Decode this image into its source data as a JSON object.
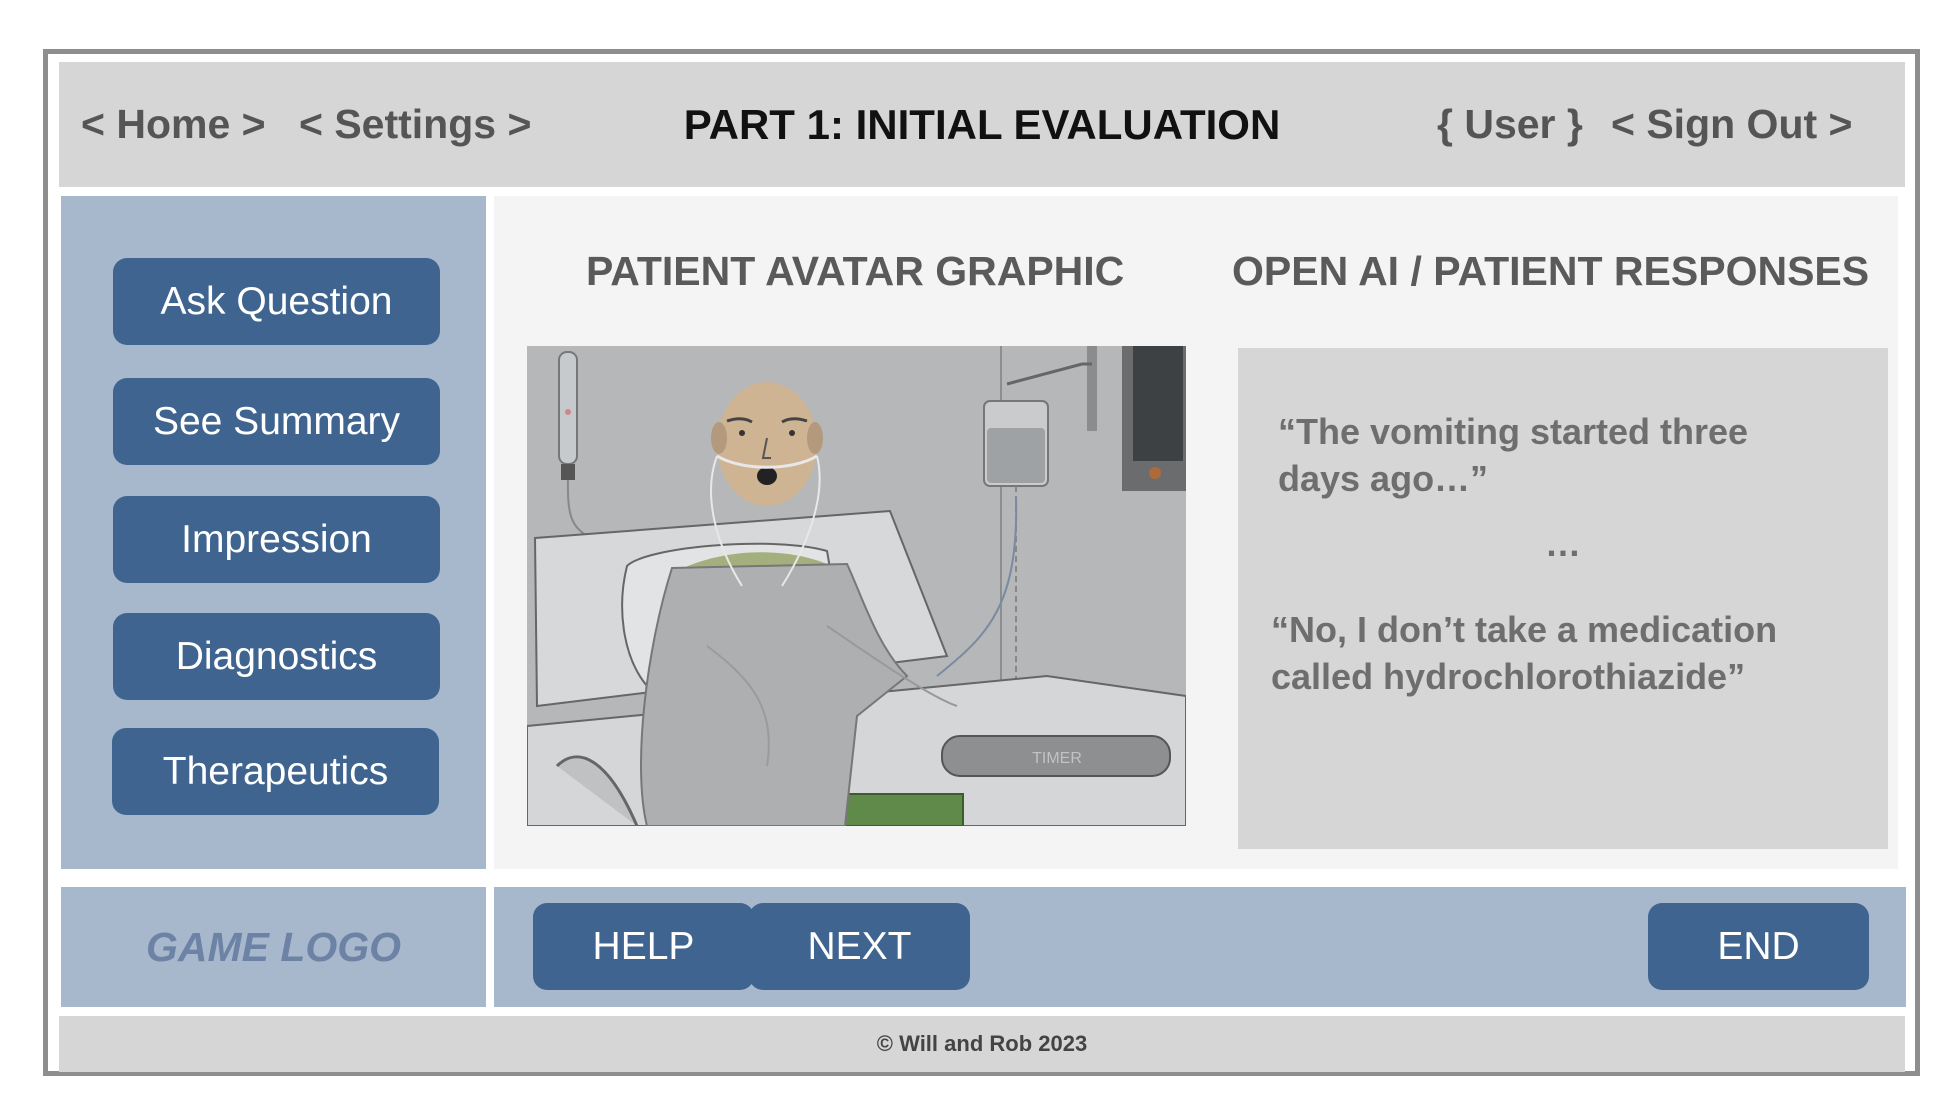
{
  "header": {
    "home_link": "< Home >",
    "settings_link": "< Settings >",
    "title": "PART 1: INITIAL EVALUATION",
    "user_label": "{ User }",
    "sign_out_link": "< Sign Out >"
  },
  "sidebar": {
    "items": [
      {
        "label": "Ask Question"
      },
      {
        "label": "See Summary"
      },
      {
        "label": "Impression"
      },
      {
        "label": "Diagnostics"
      },
      {
        "label": "Therapeutics"
      }
    ]
  },
  "main": {
    "avatar_heading": "PATIENT AVATAR GRAPHIC",
    "responses_heading": "OPEN AI / PATIENT RESPONSES",
    "avatar_timer_label": "TIMER",
    "responses": [
      "“The vomiting started three days ago…”",
      "…",
      "“No, I don’t take a medication called hydrochlorothiazide”"
    ]
  },
  "footer_bar": {
    "logo": "GAME LOGO",
    "help_button": "HELP",
    "next_button": "NEXT",
    "end_button": "END"
  },
  "copyright": "© Will and Rob 2023",
  "colors": {
    "button_blue": "#3f648f",
    "panel_blue": "#a8b8cc",
    "header_gray": "#d6d6d6"
  }
}
